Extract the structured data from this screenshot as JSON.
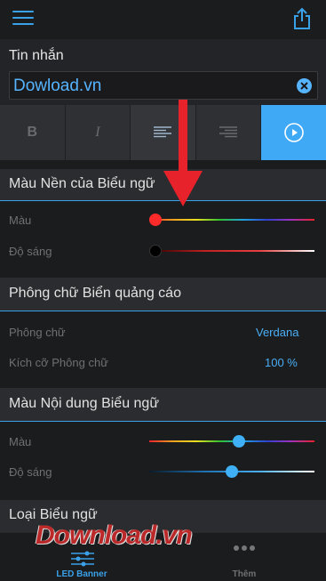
{
  "header": {
    "menu_icon": "hamburger-menu-icon",
    "share_icon": "share-icon"
  },
  "message": {
    "label": "Tin nhắn",
    "value": "Dowload.vn",
    "clear_icon": "clear-icon"
  },
  "format": {
    "bold": "B",
    "italic": "I",
    "align_left_icon": "align-left-icon",
    "align_right_icon": "align-right-icon",
    "play_icon": "play-icon"
  },
  "background": {
    "title": "Màu Nền của Biểu ngữ",
    "color_label": "Màu",
    "brightness_label": "Độ sáng",
    "color_level": 0.0,
    "brightness_level": 0.0
  },
  "font": {
    "title": "Phông chữ Biển quảng cáo",
    "font_label": "Phông chữ",
    "font_value": "Verdana",
    "size_label": "Kích cỡ Phông chữ",
    "size_value": "100 %"
  },
  "content": {
    "title": "Màu Nội dung Biểu ngữ",
    "color_label": "Màu",
    "brightness_label": "Độ sáng",
    "color_level": 0.54,
    "brightness_level": 0.5
  },
  "type_section": {
    "title": "Loại Biểu ngữ"
  },
  "tabs": {
    "led_banner": "LED Banner",
    "more": "Thêm"
  },
  "watermark": "Download.vn",
  "colors": {
    "accent": "#3aa0e8",
    "active_button": "#3fa9f5",
    "arrow": "#e8222a"
  }
}
